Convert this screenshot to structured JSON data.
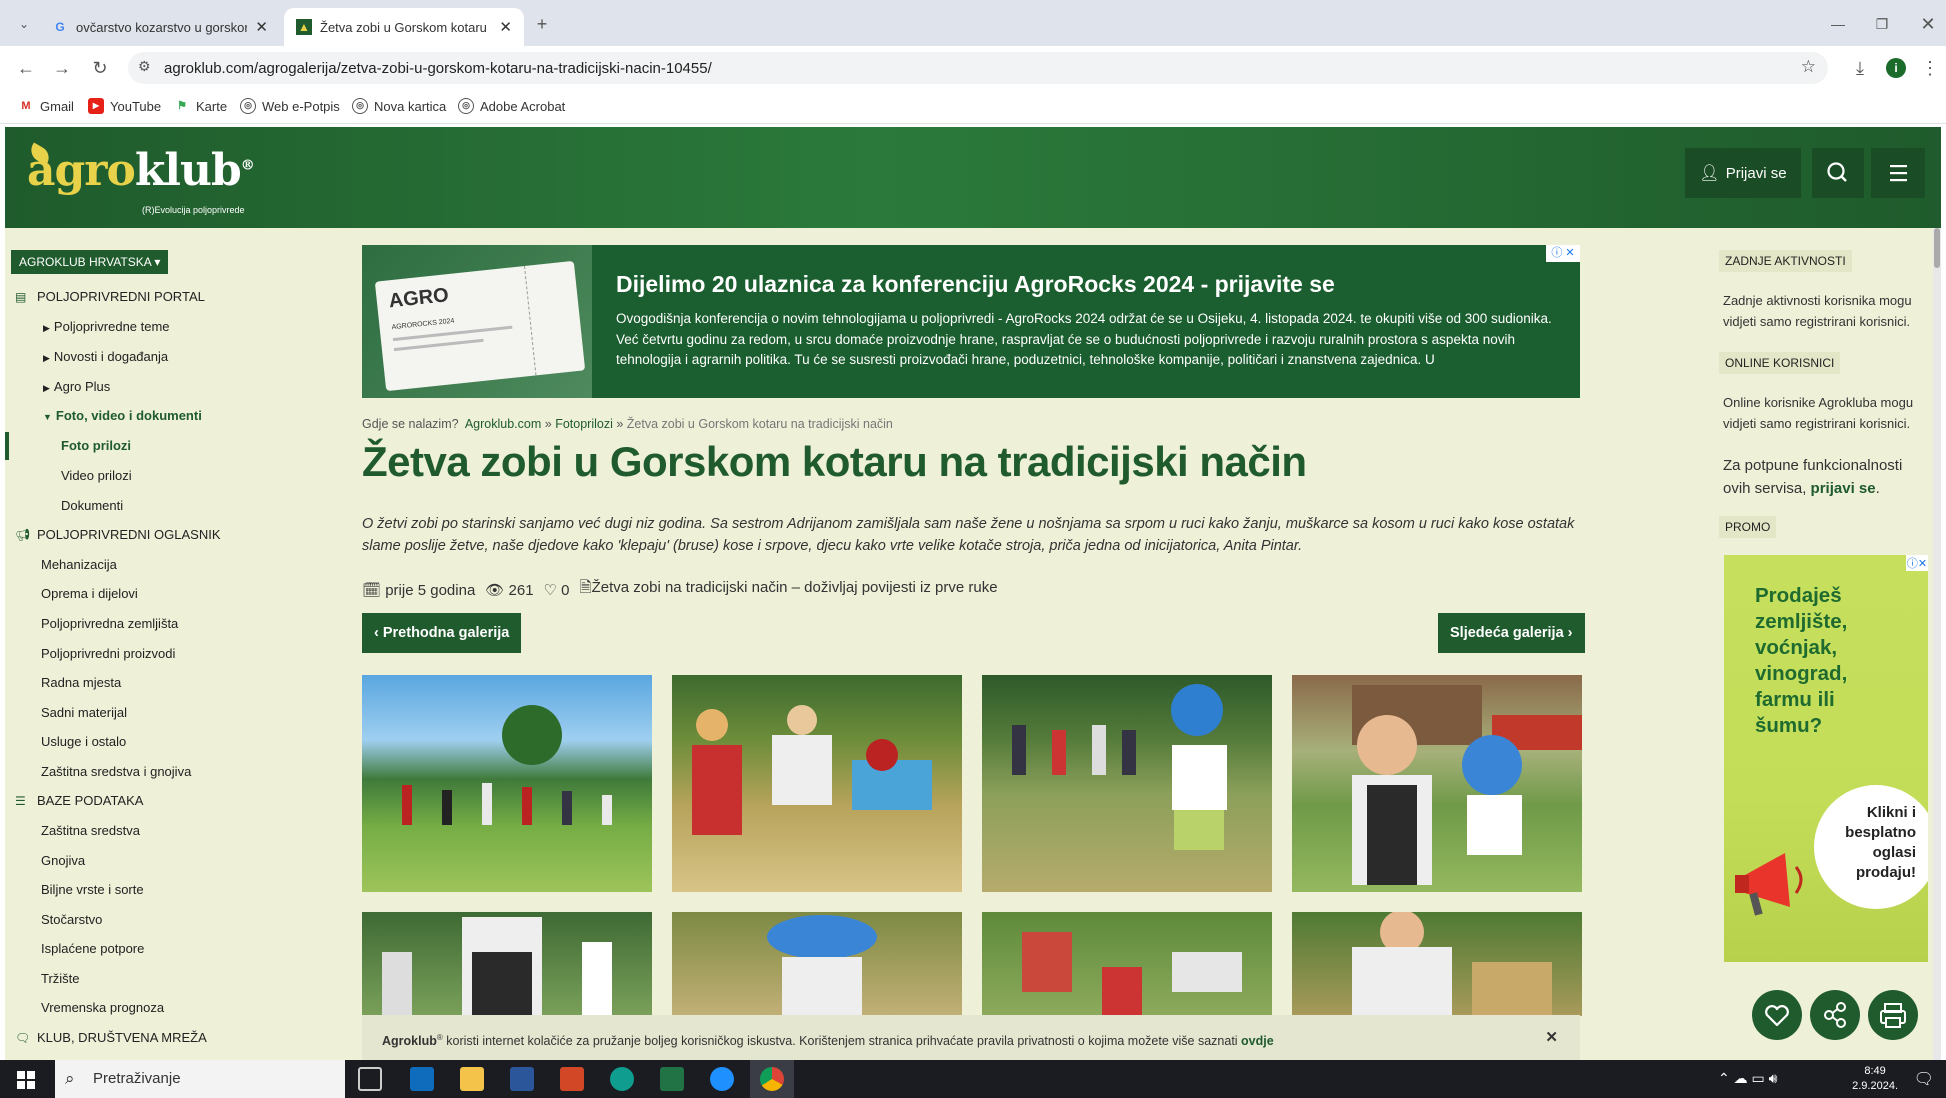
{
  "browser": {
    "tabs": [
      {
        "label": "ovčarstvo kozarstvo u gorskom",
        "icon": "google-icon"
      },
      {
        "label": "Žetva zobi u Gorskom kotaru n",
        "icon": "agroklub-favicon"
      }
    ],
    "url": "agroklub.com/agrogalerija/zetva-zobi-u-gorskom-kotaru-na-tradicijski-nacin-10455/",
    "bookmarks": [
      "Gmail",
      "YouTube",
      "Karte",
      "Web e-Potpis",
      "Nova kartica",
      "Adobe Acrobat"
    ]
  },
  "site": {
    "logo_text": "agroklub",
    "logo_agro": "agro",
    "logo_klub": "klub",
    "logo_reg": "®",
    "logo_tagline": "(R)Evolucija poljoprivrede",
    "login_label": "Prijavi se"
  },
  "sidebar": {
    "region": "AGROKLUB HRVATSKA",
    "sections": [
      {
        "label": "POLJOPRIVREDNI PORTAL",
        "icon": "newspaper-icon"
      },
      {
        "label": "POLJOPRIVREDNI OGLASNIK",
        "icon": "megaphone-icon"
      },
      {
        "label": "BAZE PODATAKA",
        "icon": "database-icon"
      },
      {
        "label": "KLUB, DRUŠTVENA MREŽA",
        "icon": "chat-icon"
      }
    ],
    "portal_items": [
      "Poljoprivredne teme",
      "Novosti i događanja",
      "Agro Plus",
      "Foto, video i dokumenti"
    ],
    "media_items": [
      "Foto prilozi",
      "Video prilozi",
      "Dokumenti"
    ],
    "oglasnik_items": [
      "Mehanizacija",
      "Oprema i dijelovi",
      "Poljoprivredna zemljišta",
      "Poljoprivredni proizvodi",
      "Radna mjesta",
      "Sadni materijal",
      "Usluge i ostalo",
      "Zaštitna sredstva i gnojiva"
    ],
    "baze_items": [
      "Zaštitna sredstva",
      "Gnojiva",
      "Biljne vrste i sorte",
      "Stočarstvo",
      "Isplaćene potpore",
      "Tržište",
      "Vremenska prognoza"
    ]
  },
  "banner": {
    "title": "Dijelimo 20 ulaznica za konferenciju AgroRocks 2024 - prijavite se",
    "text": "Ovogodišnja konferencija o novim tehnologijama u poljoprivredi - AgroRocks 2024 održat će se u Osijeku, 4. listopada 2024. te okupiti više od 300 sudionika. Već četvrtu godinu za redom, u srcu domaće proizvodnje hrane, raspravljat će se o budućnosti poljoprivrede i razvoju ruralnih prostora s aspekta novih tehnologija i agrarnih politika. Tu će se susresti proizvođači hrane, poduzetnici, tehnološke kompanije, političari i znanstvena zajednica. U",
    "ticket_text": "AGRO",
    "ticket_line": "AGROROCKS 2024"
  },
  "breadcrumb": {
    "prefix": "Gdje se nalazim?",
    "home": "Agroklub.com",
    "sep1": "»",
    "section": "Fotoprilozi",
    "sep2": "»",
    "current": "Žetva zobi u Gorskom kotaru na tradicijski način"
  },
  "article": {
    "title": "Žetva zobi u Gorskom kotaru na tradicijski način",
    "intro": "O žetvi zobi po starinski sanjamo već dugi niz godina. Sa sestrom Adrijanom zamišljala sam naše žene u nošnjama sa srpom u ruci kako žanju, muškarce sa kosom u ruci kako kose ostatak slame poslije žetve, naše djedove kako 'klepaju' (bruse) kose i srpove, djecu kako vrte velike kotače stroja, priča jedna od inicijatorica, Anita Pintar.",
    "age": "prije 5 godina",
    "views": "261",
    "likes": "0",
    "related": "Žetva zobi na tradicijski način – doživljaj povijesti iz prve ruke",
    "prev_label": "‹ Prethodna galerija",
    "next_label": "Sljedeća galerija ›"
  },
  "right": {
    "activity_label": "ZADNJE AKTIVNOSTI",
    "activity_text": "Zadnje aktivnosti korisnika mogu vidjeti samo registrirani korisnici.",
    "online_label": "ONLINE KORISNICI",
    "online_text": "Online korisnike Agrokluba mogu vidjeti samo registrirani korisnici.",
    "full_text_pre": "Za potpune funkcionalnosti ovih servisa,",
    "full_text_link": "prijavi se",
    "full_text_post": ".",
    "promo_label": "PROMO",
    "promo_question": "Prodaješ zemljište, voćnjak, vinograd, farmu ili šumu?",
    "promo_cta": "Klikni i besplatno oglasi prodaju!"
  },
  "cookie": {
    "brand": "Agroklub",
    "sup": "®",
    "text": " koristi internet kolačiće za pružanje boljeg korisničkog iskustva. Korištenjem stranica prihvaćate pravila privatnosti o kojima možete više saznati ",
    "link": "ovdje"
  },
  "taskbar": {
    "search_placeholder": "Pretraživanje",
    "time": "8:49",
    "date": "2.9.2024."
  },
  "colors": {
    "brand_green": "#1f5b2c",
    "page_bg": "#eef0d8",
    "promo_green": "#c6e05e"
  }
}
